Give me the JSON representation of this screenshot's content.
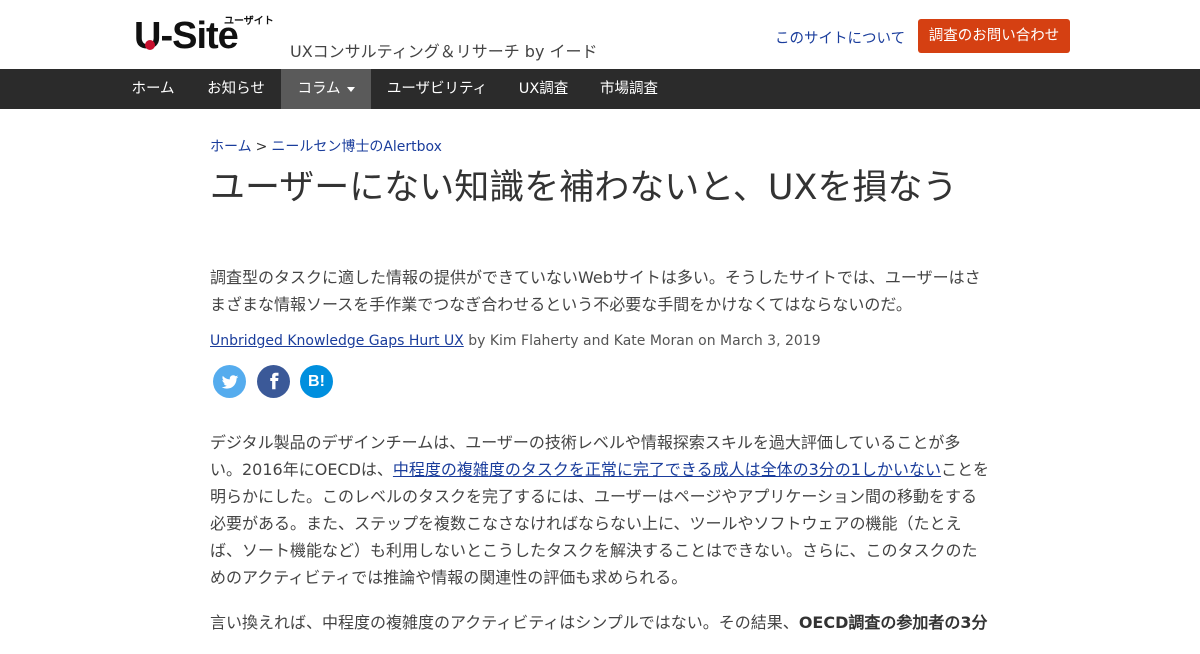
{
  "header": {
    "logo_text": "U-Site",
    "logo_sub": "ユーザイト",
    "tagline": "UXコンサルティング＆リサーチ by イード",
    "about_link": "このサイトについて",
    "contact_button": "調査のお問い合わせ"
  },
  "nav": {
    "items": [
      {
        "label": "ホーム"
      },
      {
        "label": "お知らせ"
      },
      {
        "label": "コラム"
      },
      {
        "label": "ユーザビリティ"
      },
      {
        "label": "UX調査"
      },
      {
        "label": "市場調査"
      }
    ]
  },
  "breadcrumb": {
    "home": "ホーム",
    "separator": ">",
    "current": "ニールセン博士のAlertbox"
  },
  "article": {
    "title": "ユーザーにない知識を補わないと、UXを損なう",
    "lead": "調査型のタスクに適した情報の提供ができていないWebサイトは多い。そうしたサイトでは、ユーザーはさまざまな情報ソースを手作業でつなぎ合わせるという不必要な手間をかけなくてはならないのだ。",
    "source_link": "Unbridged Knowledge Gaps Hurt UX",
    "source_byline": " by Kim Flaherty and Kate Moran on March 3, 2019",
    "share": {
      "twitter_icon": "twitter-icon",
      "facebook_icon": "facebook-icon",
      "hatena_label": "B!"
    },
    "p1_before": "デジタル製品のデザインチームは、ユーザーの技術レベルや情報探索スキルを過大評価していることが多い。2016年にOECDは、",
    "p1_link": "中程度の複雑度のタスクを正常に完了できる成人は全体の3分の1しかいない",
    "p1_after": "ことを明らかにした。このレベルのタスクを完了するには、ユーザーはページやアプリケーション間の移動をする必要がある。また、ステップを複数こなさなければならない上に、ツールやソフトウェアの機能（たとえば、ソート機能など）も利用しないとこうしたタスクを解決することはできない。さらに、このタスクのためのアクティビティでは推論や情報の関連性の評価も求められる。",
    "p2_before": "言い換えれば、中程度の複雑度のアクティビティはシンプルではない。その結果、",
    "p2_bold": "OECD調査の参加者の3分"
  },
  "colors": {
    "nav_bg": "#2b2b2b",
    "contact_bg": "#d54012",
    "link": "#1a3d9c",
    "twitter": "#55acee",
    "facebook": "#3b5998",
    "hatena": "#008fde",
    "logo_dot": "#c8102e"
  }
}
